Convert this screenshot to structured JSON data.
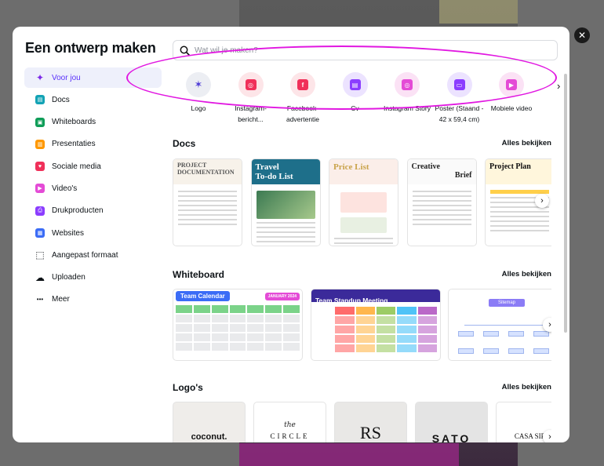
{
  "modal": {
    "title": "Een ontwerp maken",
    "close_glyph": "✕"
  },
  "search": {
    "placeholder": "Wat wil je maken?"
  },
  "sidebar": {
    "items": [
      {
        "label": "Voor jou",
        "icon": "sparkle-icon",
        "color": "#7d2ae8"
      },
      {
        "label": "Docs",
        "icon": "docs-icon",
        "color": "#13a3b5"
      },
      {
        "label": "Whiteboards",
        "icon": "whiteboard-icon",
        "color": "#0f9d58"
      },
      {
        "label": "Presentaties",
        "icon": "presentation-icon",
        "color": "#ff9800"
      },
      {
        "label": "Sociale media",
        "icon": "heart-icon",
        "color": "#f0305a"
      },
      {
        "label": "Video's",
        "icon": "video-icon",
        "color": "#e44bd6"
      },
      {
        "label": "Drukproducten",
        "icon": "printer-icon",
        "color": "#8b3dff"
      },
      {
        "label": "Websites",
        "icon": "browser-icon",
        "color": "#3b6cf6"
      },
      {
        "label": "Aangepast formaat",
        "icon": "custom-size-icon",
        "color": "#0d1216"
      },
      {
        "label": "Uploaden",
        "icon": "cloud-upload-icon",
        "color": "#0d1216"
      },
      {
        "label": "Meer",
        "icon": "more-icon",
        "color": "#0d1216"
      }
    ]
  },
  "categories": [
    {
      "label": "Logo",
      "icon": "logo-icon",
      "bg": "#eceef3",
      "fg": "#4d3bd6"
    },
    {
      "label": "Instagram-bericht...",
      "icon": "instagram-icon",
      "bg": "#fde5e8",
      "fg": "#f0305a"
    },
    {
      "label": "Facebook-advertentie",
      "icon": "facebook-icon",
      "bg": "#fde5e8",
      "fg": "#f0305a"
    },
    {
      "label": "Cv",
      "icon": "cv-icon",
      "bg": "#ece3ff",
      "fg": "#8b3dff"
    },
    {
      "label": "Instagram Story",
      "icon": "instagram-story-icon",
      "bg": "#fbe2f5",
      "fg": "#e44bd6"
    },
    {
      "label": "Poster (Staand - 42 x 59,4 cm)",
      "icon": "poster-icon",
      "bg": "#ece3ff",
      "fg": "#8b3dff"
    },
    {
      "label": "Mobiele video",
      "icon": "mobile-video-icon",
      "bg": "#fbe2f5",
      "fg": "#e44bd6"
    }
  ],
  "sections": {
    "docs": {
      "title": "Docs",
      "see_all": "Alles bekijken"
    },
    "whiteboard": {
      "title": "Whiteboard",
      "see_all": "Alles bekijken"
    },
    "logos": {
      "title": "Logo's",
      "see_all": "Alles bekijken"
    }
  },
  "doc_cards": [
    {
      "line1": "PROJECT",
      "line2": "DOCUMENTATION"
    },
    {
      "line1": "Travel",
      "line2": "To-do List"
    },
    {
      "line1": "Price List",
      "line2": ""
    },
    {
      "line1": "Creative",
      "line2": "Brief"
    },
    {
      "line1": "Project Plan",
      "line2": ""
    }
  ],
  "whiteboard_cards": [
    {
      "title": "Team Calendar",
      "badge": "JANUARY 2024"
    },
    {
      "title": "Team Standup Meeting",
      "badge": ""
    },
    {
      "title": "Sitemap",
      "badge": ""
    }
  ],
  "logo_cards": [
    {
      "text": "coconut."
    },
    {
      "text": "CIRCLE",
      "script": "the"
    },
    {
      "text": "RS"
    },
    {
      "text": "SATO"
    },
    {
      "text": "CASA SIRE"
    }
  ],
  "colors": {
    "accent": "#8b3dff",
    "highlight": "#e117e1"
  }
}
